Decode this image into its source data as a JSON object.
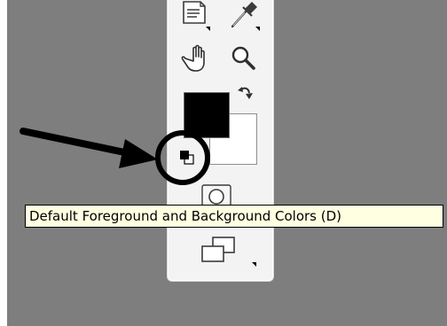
{
  "tooltip": {
    "text": "Default Foreground and Background Colors (D)"
  },
  "tools": [
    {
      "name": "notes-tool",
      "icon": "note-icon"
    },
    {
      "name": "eyedropper-tool",
      "icon": "eyedropper-icon"
    },
    {
      "name": "hand-tool",
      "icon": "hand-icon"
    },
    {
      "name": "zoom-tool",
      "icon": "magnifier-icon"
    },
    {
      "name": "quick-mask-tool",
      "icon": "quick-mask-icon"
    },
    {
      "name": "screen-mode-tool",
      "icon": "screen-mode-icon"
    }
  ],
  "colors": {
    "foreground": "#000000",
    "background": "#ffffff",
    "workspace": "#7e7e7e",
    "tooltip_bg": "#ffffe1",
    "panel": "#f3f3f3"
  }
}
